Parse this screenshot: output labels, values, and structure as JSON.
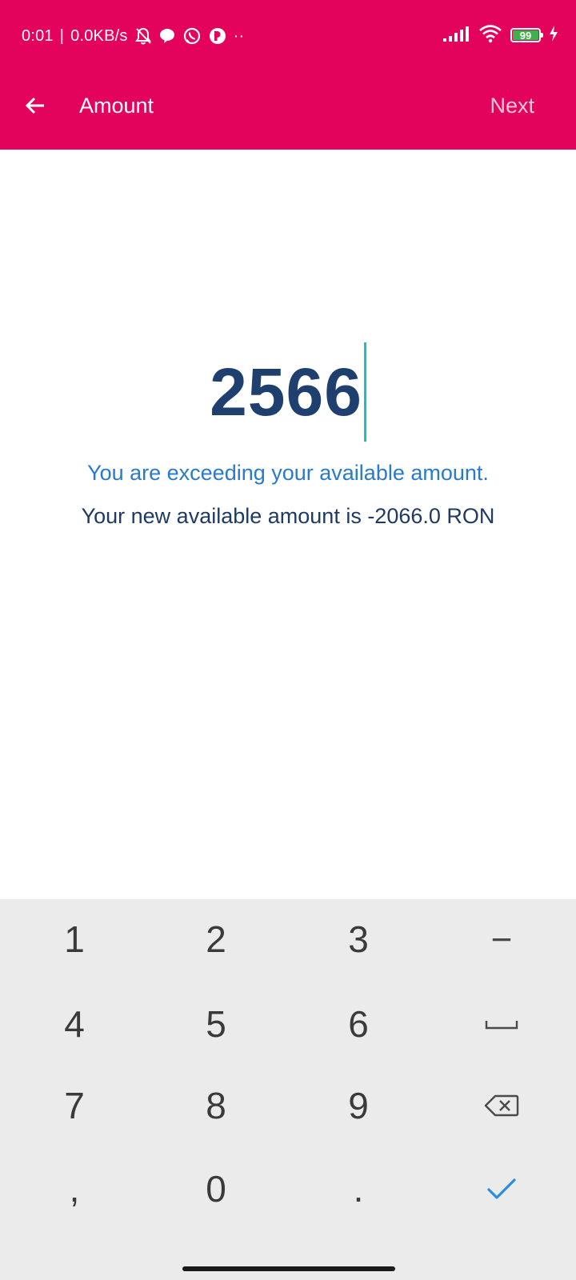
{
  "status_bar": {
    "time": "0:01",
    "separator": "|",
    "net_speed": "0.0KB/s",
    "battery": "99",
    "more": "··"
  },
  "app_bar": {
    "title": "Amount",
    "next_label": "Next"
  },
  "amount": {
    "value": "2566"
  },
  "messages": {
    "warning": "You are exceeding your available amount.",
    "available": "Your new available amount is -2066.0 RON"
  },
  "keyboard": {
    "keys": {
      "k1": "1",
      "k2": "2",
      "k3": "3",
      "dash": "−",
      "k4": "4",
      "k5": "5",
      "k6": "6",
      "k7": "7",
      "k8": "8",
      "k9": "9",
      "comma": ",",
      "k0": "0",
      "dot": "."
    },
    "icons": {
      "space": "space-icon",
      "backspace": "backspace-icon",
      "done": "checkmark-icon"
    }
  },
  "colors": {
    "accent": "#e3025c",
    "amount_text": "#1f3f6e",
    "warning_text": "#2a7acb",
    "caret": "#19c3bb",
    "done_check": "#2b8ce0"
  }
}
